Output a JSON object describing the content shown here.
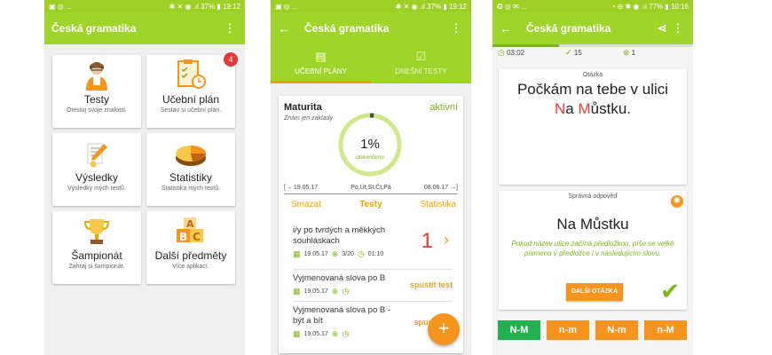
{
  "colors": {
    "green": "#9fd42a",
    "orange": "#f7941d",
    "red": "#e53935",
    "dark_green": "#7cb518"
  },
  "screen1": {
    "status": {
      "left": "▣ ◎ ...",
      "right": "✱ ✕ ◉ .ıl 37% ▮ 19:12"
    },
    "title": "Česká gramatika",
    "cards": [
      {
        "title": "Testy",
        "subtitle": "Otestuj svoje znalosti.",
        "icon": "teacher-icon"
      },
      {
        "title": "Učební plán",
        "subtitle": "Sestav si učební plán.",
        "icon": "checklist-icon",
        "badge": "4"
      },
      {
        "title": "Výsledky",
        "subtitle": "Výsledky mých testů.",
        "icon": "pencil-icon"
      },
      {
        "title": "Statistiky",
        "subtitle": "Statistika mých testů.",
        "icon": "pie-chart-icon"
      },
      {
        "title": "Šampionát",
        "subtitle": "Zahraj si šampionát.",
        "icon": "trophy-icon"
      },
      {
        "title": "Další předměty",
        "subtitle": "Více aplikací.",
        "icon": "abc-blocks-icon"
      }
    ]
  },
  "screen2": {
    "status": {
      "left": "▣ ◎ ...",
      "right": "✱ ✕ ◉ .ıl 37% ▮ 19:12"
    },
    "title": "Česká gramatika",
    "tabs": [
      "UČEBNÍ PLÁNY",
      "DNEŠNÍ TESTY"
    ],
    "plan": {
      "name": "Maturita",
      "subtitle": "Znám jen základy",
      "state": "aktivní",
      "percent": "1%",
      "percent_value": 1,
      "done_label": "dokončeno",
      "start": "19.05.17",
      "days": "Po,Út,St,Čt,Pá",
      "end": "08.06.17",
      "actions": [
        "Smazat",
        "Testy",
        "Statistika"
      ]
    },
    "tests": [
      {
        "name": "i/y po tvrdých a měkkých souhláskach",
        "date": "19.05.17",
        "score": "3/20",
        "time": "01:10",
        "big": "1"
      },
      {
        "name": "Vyjmenovaná slova po B",
        "date": "19.05.17",
        "action": "spustit test"
      },
      {
        "name": "Vyjmenovaná slova po B - být a bít",
        "date": "19.05.17",
        "action": "spustit"
      }
    ],
    "fab": "+"
  },
  "screen3": {
    "status": {
      "left": "✪ ◎ ✉ ...",
      "right": "◔ ⊖ ✱ ◉ .ıl 77% ▮ 10:16"
    },
    "title": "Česká gramatika",
    "progress_fraction": 0.33,
    "timer": "03:02",
    "correct": "15",
    "wrong": "1",
    "question_label": "Otázka",
    "question_parts": [
      "Počkám na tebe v ulici ",
      "N",
      "a ",
      "M",
      "ůstku."
    ],
    "answer_label": "Správná odpověď",
    "answer": "Na Můstku",
    "explanation": "Pokud název ulice začíná předložkou, píše se velké písmeno v předložce i v následujícím slovu.",
    "next_button": "DALŠÍ OTÁZKA",
    "options": [
      {
        "label": "N-M",
        "color": "#22b14c"
      },
      {
        "label": "n-m",
        "color": "#f7941d"
      },
      {
        "label": "N-m",
        "color": "#f7941d"
      },
      {
        "label": "n-M",
        "color": "#f7941d"
      }
    ]
  }
}
